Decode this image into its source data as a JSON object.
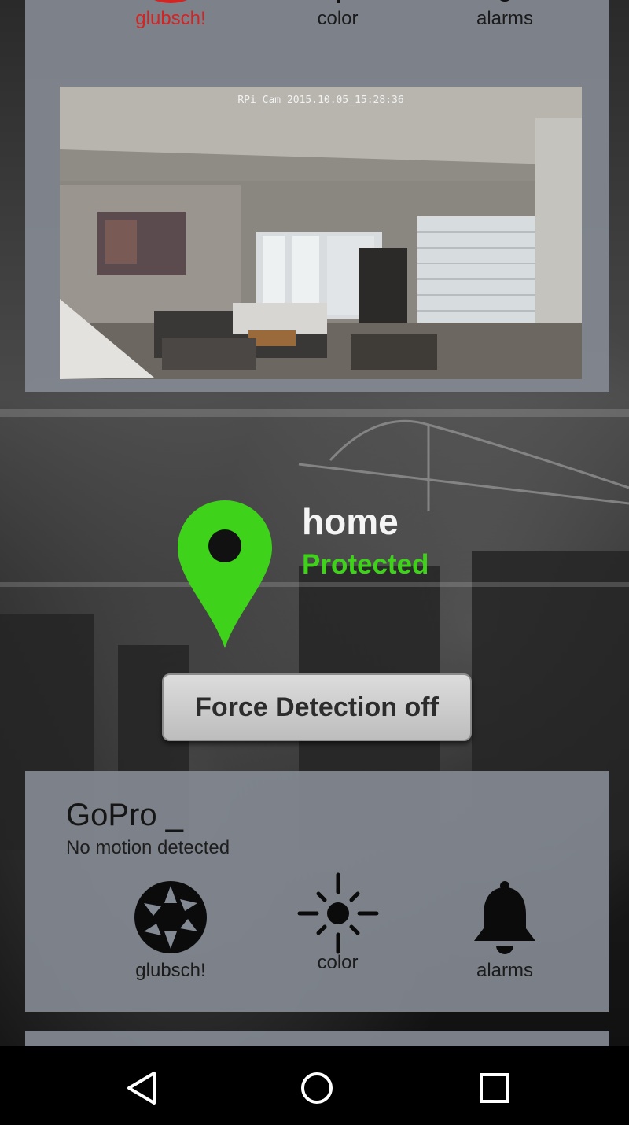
{
  "top_card": {
    "actions": [
      {
        "label": "glubsch!",
        "icon": "shutter-icon",
        "active": true
      },
      {
        "label": "color",
        "icon": "brightness-icon"
      },
      {
        "label": "alarms",
        "icon": "bell-icon"
      }
    ],
    "camera": {
      "overlay_text": "RPi Cam 2015.10.05_15:28:36"
    }
  },
  "location": {
    "name": "home",
    "status": "Protected",
    "pin_color": "#3fd21a"
  },
  "force_button": {
    "label": "Force Detection off"
  },
  "device_card": {
    "name": "GoPro _",
    "status": "No motion detected",
    "actions": [
      {
        "label": "glubsch!",
        "icon": "shutter-icon"
      },
      {
        "label": "color",
        "icon": "brightness-icon"
      },
      {
        "label": "alarms",
        "icon": "bell-icon"
      }
    ]
  },
  "nav": {
    "back": "back-icon",
    "home": "home-icon",
    "recents": "recents-icon"
  },
  "colors": {
    "card": "#848a93",
    "accent_active": "#d32424",
    "protected": "#3fd21a"
  }
}
